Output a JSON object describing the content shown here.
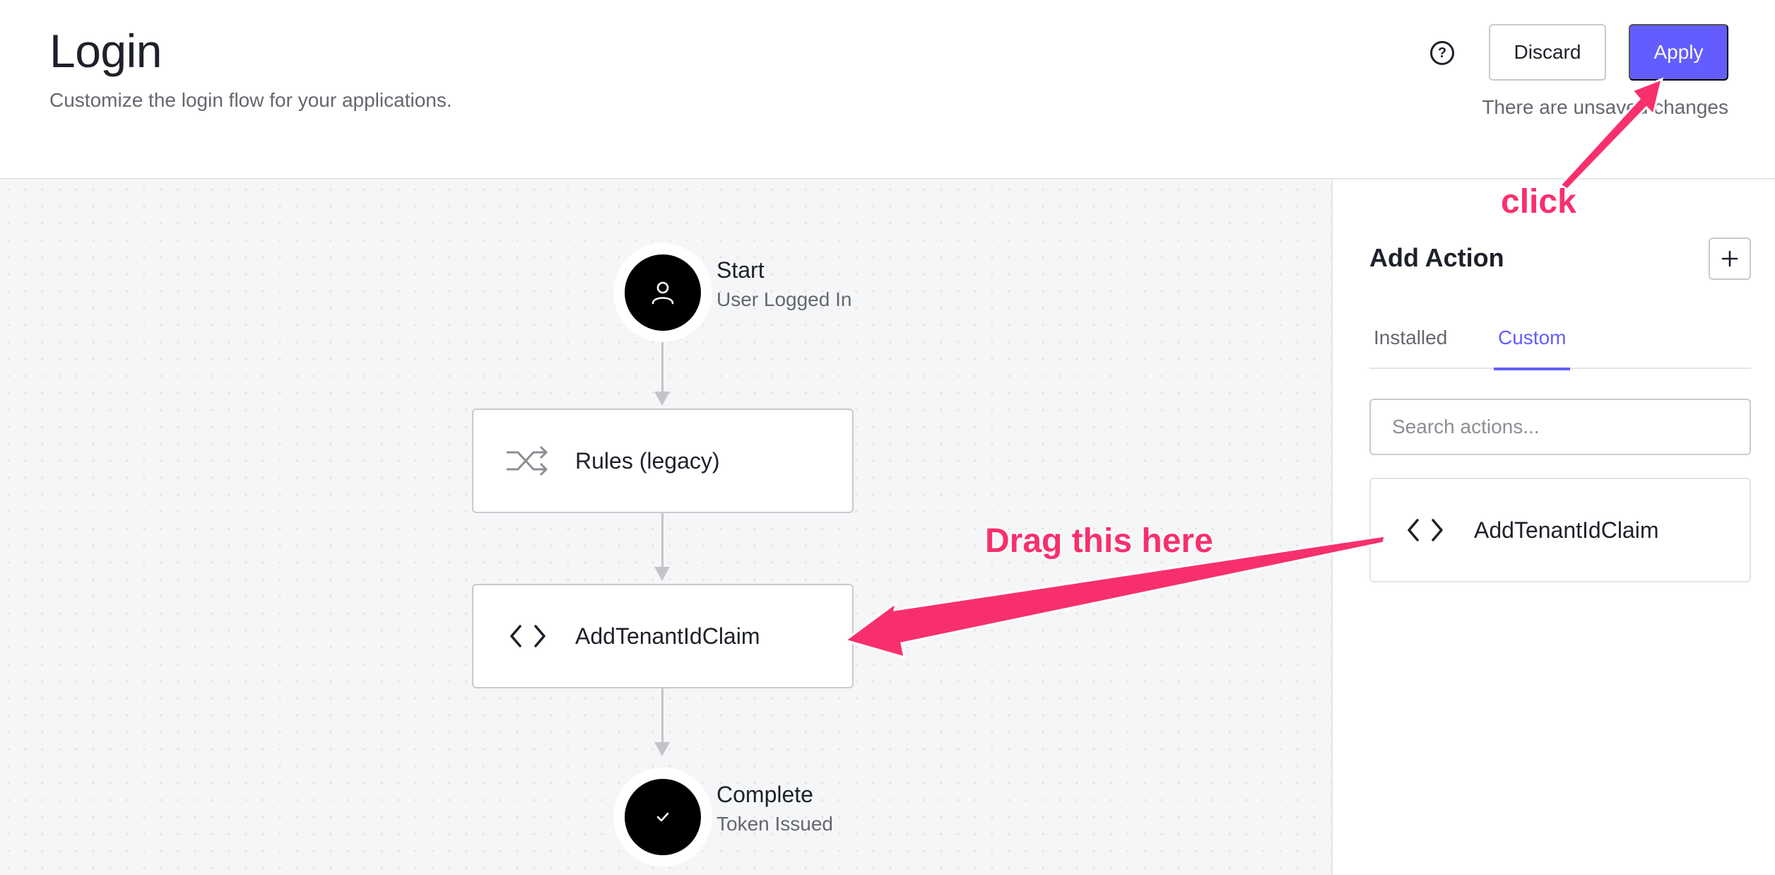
{
  "header": {
    "title": "Login",
    "subtitle": "Customize the login flow for your applications.",
    "help_icon": "question-circle-icon",
    "discard_label": "Discard",
    "apply_label": "Apply",
    "unsaved_text": "There are unsaved changes"
  },
  "flow": {
    "start": {
      "title": "Start",
      "subtitle": "User Logged In",
      "icon": "user-icon"
    },
    "steps": [
      {
        "label": "Rules (legacy)",
        "icon": "shuffle-icon"
      },
      {
        "label": "AddTenantIdClaim",
        "icon": "code-icon"
      }
    ],
    "end": {
      "title": "Complete",
      "subtitle": "Token Issued",
      "icon": "check-icon"
    }
  },
  "sidebar": {
    "title": "Add Action",
    "add_icon": "plus-icon",
    "tabs": [
      {
        "label": "Installed",
        "active": false
      },
      {
        "label": "Custom",
        "active": true
      }
    ],
    "search_placeholder": "Search actions...",
    "actions": [
      {
        "label": "AddTenantIdClaim",
        "icon": "code-icon"
      }
    ]
  },
  "annotations": {
    "drag": "Drag this here",
    "click": "click",
    "color": "#f7306d"
  },
  "colors": {
    "accent": "#635dff",
    "canvas": "#f5f6f7"
  }
}
